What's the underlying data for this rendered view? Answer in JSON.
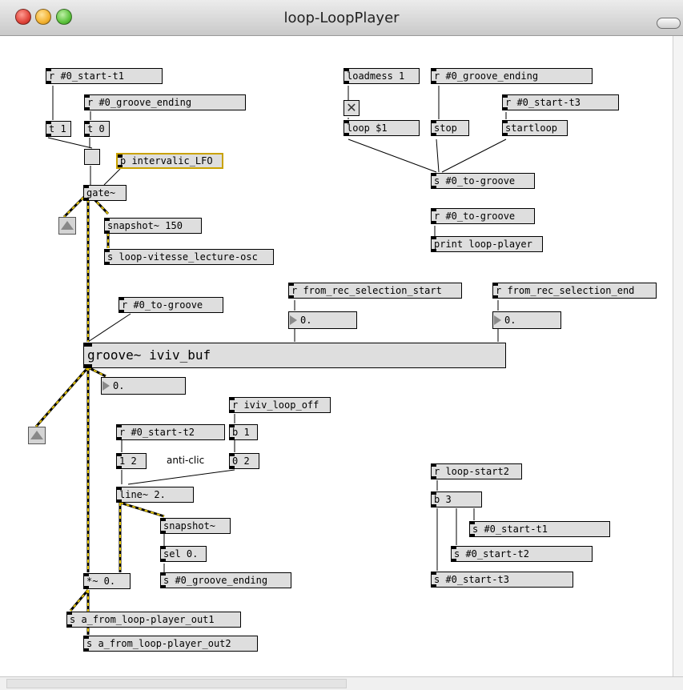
{
  "window": {
    "title": "loop-LoopPlayer"
  },
  "patch": {
    "objects": {
      "r_start_t1": "r #0_start-t1",
      "r_groove_ending_a": "r #0_groove_ending",
      "t1": "t 1",
      "t0": "t 0",
      "p_intervalic": "p intervalic_LFO",
      "gate": "gate~",
      "snapshot150": "snapshot~ 150",
      "s_vitesse": "s loop-vitesse_lecture-osc",
      "r_to_groove_a": "r #0_to-groove",
      "loadmess": "loadmess 1",
      "r_groove_ending_b": "r #0_groove_ending",
      "r_start_t3": "r #0_start-t3",
      "loop_msg": "loop $1",
      "stop_msg": "stop",
      "startloop_msg": "startloop",
      "s_to_groove": "s #0_to-groove",
      "r_to_groove_b": "r #0_to-groove",
      "print": "print loop-player",
      "r_sel_start": "r from_rec_selection_start",
      "r_sel_end": "r from_rec_selection_end",
      "groove": "groove~ iviv_buf",
      "r_loop_off": "r iviv_loop_off",
      "r_start_t2": "r #0_start-t2",
      "b1": "b 1",
      "msg12": "1 2",
      "msg02": "0 2",
      "line2": "line~ 2.",
      "snapshot": "snapshot~",
      "sel0": "sel 0.",
      "s_groove_ending": "s #0_groove_ending",
      "mult": "*~ 0.",
      "s_out1": "s a_from_loop-player_out1",
      "s_out2": "s a_from_loop-player_out2",
      "r_loop_start2": "r loop-start2",
      "b3": "b 3",
      "s_start_t1": "s #0_start-t1",
      "s_start_t2": "s #0_start-t2",
      "s_start_t3": "s #0_start-t3"
    },
    "numbers": {
      "sel_start": "0.",
      "sel_end": "0.",
      "groove_out": "0."
    },
    "comments": {
      "anticlic": "anti-clic"
    }
  },
  "colors": {
    "patch_cord": "#000000",
    "signal_cord": "#e3c200",
    "object_fill": "#dedede",
    "subpatch_border": "#c9a200"
  }
}
